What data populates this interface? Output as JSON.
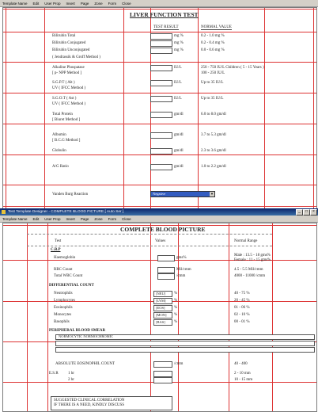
{
  "menu": [
    "Template Name",
    "Edit",
    "User Prop",
    "Insert",
    "Page",
    "Zone",
    "Form",
    "Close"
  ],
  "lft": {
    "title": "LIVER FUNCTION TEST",
    "col_result": "TEST RESULT",
    "col_normal": "NORMAL VALUE",
    "rows": [
      {
        "name": "Bilirubin Total",
        "unit": "mg %",
        "normal": "0.2 - 1.0 mg %"
      },
      {
        "name": "Bilirubin Conjugated",
        "unit": "mg %",
        "normal": "0.2 - 0.4 mg %"
      },
      {
        "name": "Bilirubin Unconjugated",
        "unit": "mg %",
        "normal": "0.0 - 0.6 mg %"
      },
      {
        "name": "( Jendrassik & Groff Method )"
      },
      {
        "name": "Alkaline Phospatase",
        "name2": "[ p- NPP Method ]",
        "unit": "IU/L",
        "normal": "250 - 750 IU/L Children ( 5 - 15 Years )",
        "normal2": "100 - 250 IU/L"
      },
      {
        "name": "S.G.P.T ( Alt )",
        "name2": "UV ( IFCC Method )",
        "unit": "IU/L",
        "normal": "Up to 35 IU/L"
      },
      {
        "name": "S.G.O.T ( Ast )",
        "name2": "UV ( IFCC Method )",
        "unit": "IU/L",
        "normal": "Up to 35 IU/L"
      },
      {
        "name": "Total Protein",
        "name2": "[ Biuret Method ]",
        "unit": "gm/dl",
        "normal": "6.0 to 8.0 gm/dl"
      },
      {
        "name": "Albumin",
        "name2": "[ B.C.G Method ]",
        "unit": "gm/dl",
        "normal": "3.7 to 5.3 gm/dl"
      },
      {
        "name": "Globulin",
        "unit": "gm/dl",
        "normal": "2.3 to 3.6 gm/dl"
      },
      {
        "name": "A/G Ratio",
        "unit": "gm/dl",
        "normal": "1.0 to 2.2 gm/dl"
      }
    ],
    "vanden_label": "Vanden Burg Reaction",
    "vanden_value": "Negative"
  },
  "window": {
    "title": "Test Template Designer - COMPLETE BLOOD PICTURE [ Auto Ser ]",
    "menu": [
      "Template Name",
      "Edit",
      "User Prop",
      "Insert",
      "Page",
      "Zone",
      "Form",
      "Close"
    ]
  },
  "cbp": {
    "title": "COMPLETE BLOOD PICTURE",
    "col_test": "Test",
    "col_values": "Values",
    "col_normal": "Normal Range",
    "cbp_label": "C.B.P",
    "hb": {
      "name": "Haemoglobin",
      "unit": "gms%",
      "normal": "Male   : 13.5 - 18 gms%",
      "normal2": "Female : 11 - 15 gms%"
    },
    "rbc": {
      "name": "RBC Count",
      "unit": "Mil/cmm",
      "normal": "4.5 - 5.5 Mil/cmm"
    },
    "wbc": {
      "name": "Total WBC Count",
      "unit": "/cmm",
      "normal": "4000 - 11000 /cmm"
    },
    "diff_label": "DIFFERENTIAL COUNT",
    "diff": [
      {
        "name": "Neutrophils",
        "code": "[NEU]",
        "unit": "%",
        "normal": "40 - 75 %"
      },
      {
        "name": "Lymphocytes",
        "code": "[LYM]",
        "unit": "%",
        "normal": "20 - 45 %"
      },
      {
        "name": "Eosinophils",
        "code": "[EOS]",
        "unit": "%",
        "normal": "01 - 06 %"
      },
      {
        "name": "Monocytes",
        "code": "[MON]",
        "unit": "%",
        "normal": "02 - 10 %"
      },
      {
        "name": "Basophils",
        "code": "[BAS]",
        "unit": "%",
        "normal": "00 - 01 %"
      }
    ],
    "smear_label": "PERIPHERAL BLOOD SMEAR",
    "smear_text": "NORMOCYTIC   NORMOCHROMIC",
    "aec": {
      "name": "ABSOLUTE EOSINOPHIL COUNT",
      "unit": "/cmm",
      "normal": "40 - 400"
    },
    "esr": {
      "name": "E.S.R",
      "hr1": "1 hr",
      "hr2": "2 hr",
      "normal1": "2 - 10 mm",
      "normal2": "10 - 15 mm"
    },
    "suggest": "SUGGESTED CLINICAL CORRELATION",
    "suggest2": "IF THERE IS A NEED, KINDLY DISCUSS"
  }
}
